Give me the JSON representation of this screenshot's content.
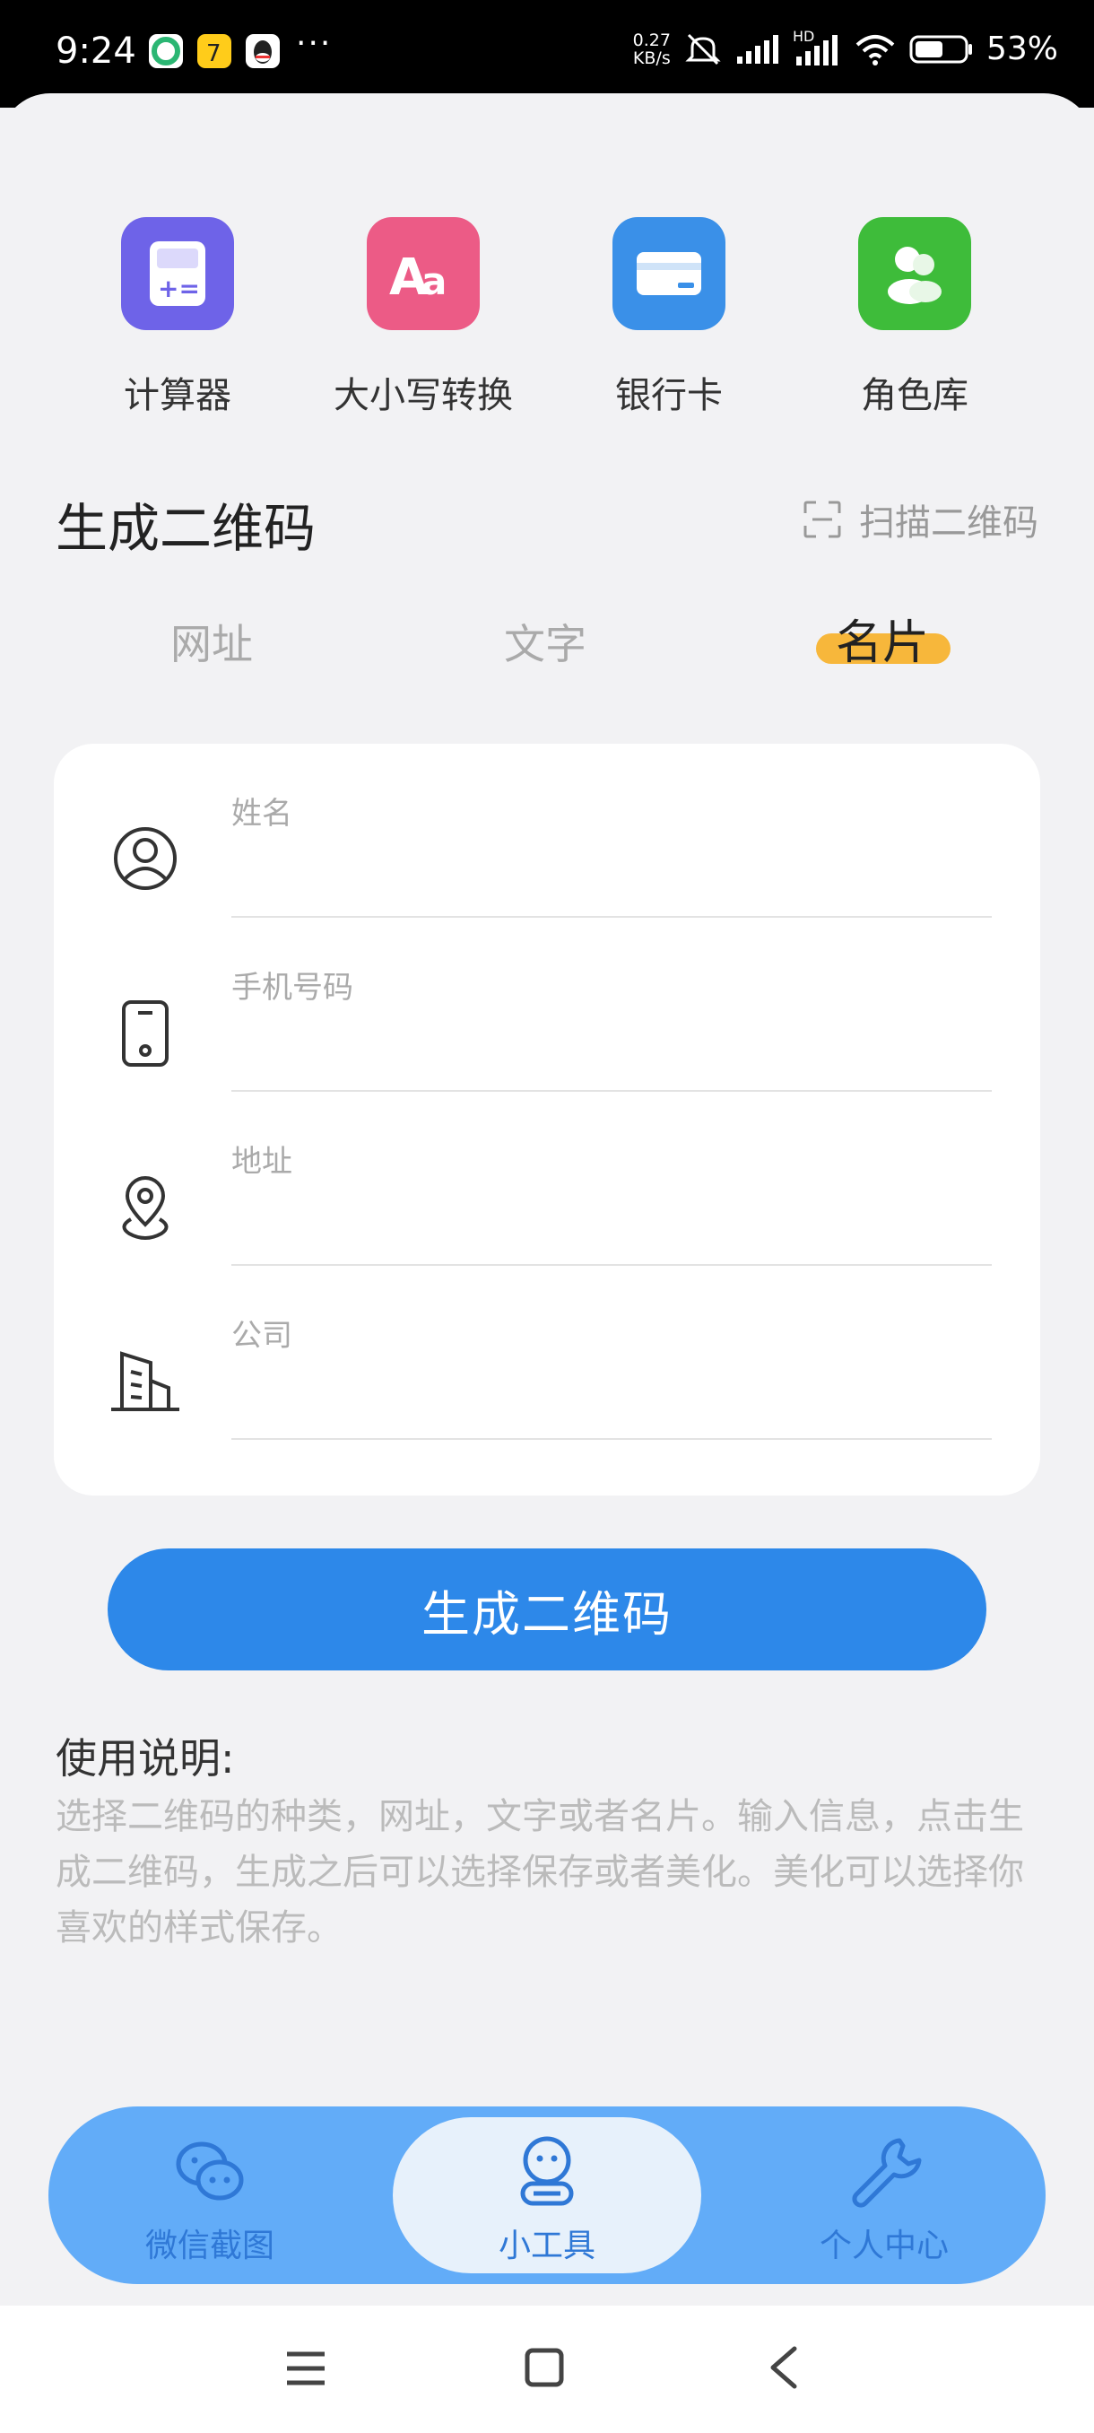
{
  "status_bar": {
    "time": "9:24",
    "speed_value": "0.27",
    "speed_unit": "KB/s",
    "network_badge": "HD",
    "battery_percent": "53%",
    "more_dots": "···"
  },
  "tools": [
    {
      "label": "计算器",
      "icon": "calculator-icon",
      "color": "#6e63e8"
    },
    {
      "label": "大小写转换",
      "icon": "text-case-icon",
      "color": "#ec5b86"
    },
    {
      "label": "银行卡",
      "icon": "bank-card-icon",
      "color": "#3a90e8"
    },
    {
      "label": "角色库",
      "icon": "character-library-icon",
      "color": "#3ebc3a"
    }
  ],
  "section": {
    "title": "生成二维码",
    "scan_label": "扫描二维码"
  },
  "tabs": {
    "items": [
      "网址",
      "文字",
      "名片"
    ],
    "active": "名片",
    "active_color": "#f7b73b"
  },
  "form": {
    "fields": [
      {
        "label": "姓名",
        "icon": "person-icon",
        "value": ""
      },
      {
        "label": "手机号码",
        "icon": "phone-icon",
        "value": ""
      },
      {
        "label": "地址",
        "icon": "location-icon",
        "value": ""
      },
      {
        "label": "公司",
        "icon": "building-icon",
        "value": ""
      }
    ]
  },
  "generate_button": {
    "label": "生成二维码",
    "color": "#2d88e9"
  },
  "instructions": {
    "title": "使用说明:",
    "text": "选择二维码的种类，网址，文字或者名片。输入信息，点击生成二维码，生成之后可以选择保存或者美化。美化可以选择你喜欢的样式保存。"
  },
  "bottom_nav": {
    "items": [
      {
        "label": "微信截图",
        "icon": "chat-bubbles-icon"
      },
      {
        "label": "小工具",
        "icon": "robot-icon"
      },
      {
        "label": "个人中心",
        "icon": "wrench-icon"
      }
    ],
    "active": "小工具",
    "bar_color": "#62acf8"
  }
}
